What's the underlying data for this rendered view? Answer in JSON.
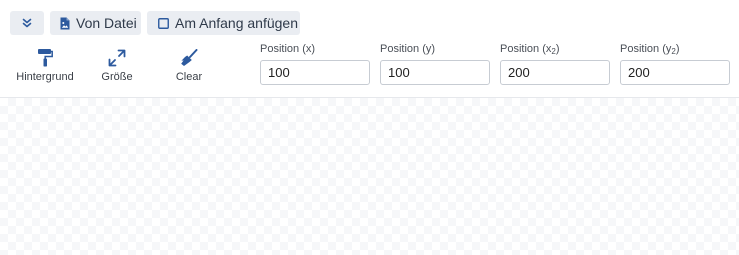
{
  "toolbar": {
    "collapse_icon": "chevrons-down-icon",
    "from_file": {
      "icon": "file-image-icon",
      "label": "Von Datei"
    },
    "prepend": {
      "icon": "checkbox-icon",
      "label": "Am Anfang anfügen",
      "checked": false
    }
  },
  "tools": [
    {
      "icon": "paint-roller-icon",
      "label": "Hintergrund"
    },
    {
      "icon": "expand-arrows-icon",
      "label": "Größe"
    },
    {
      "icon": "broom-icon",
      "label": "Clear"
    }
  ],
  "position": {
    "x": {
      "label_main": "Position (x",
      "label_sub": "",
      "label_end": ")",
      "value": "100"
    },
    "y": {
      "label_main": "Position (y",
      "label_sub": "",
      "label_end": ")",
      "value": "100"
    },
    "x2": {
      "label_main": "Position (x",
      "label_sub": "2",
      "label_end": ")",
      "value": "200"
    },
    "y2": {
      "label_main": "Position (y",
      "label_sub": "2",
      "label_end": ")",
      "value": "200"
    }
  },
  "colors": {
    "accent": "#2d5a9e",
    "button_bg": "#eaedf2"
  }
}
